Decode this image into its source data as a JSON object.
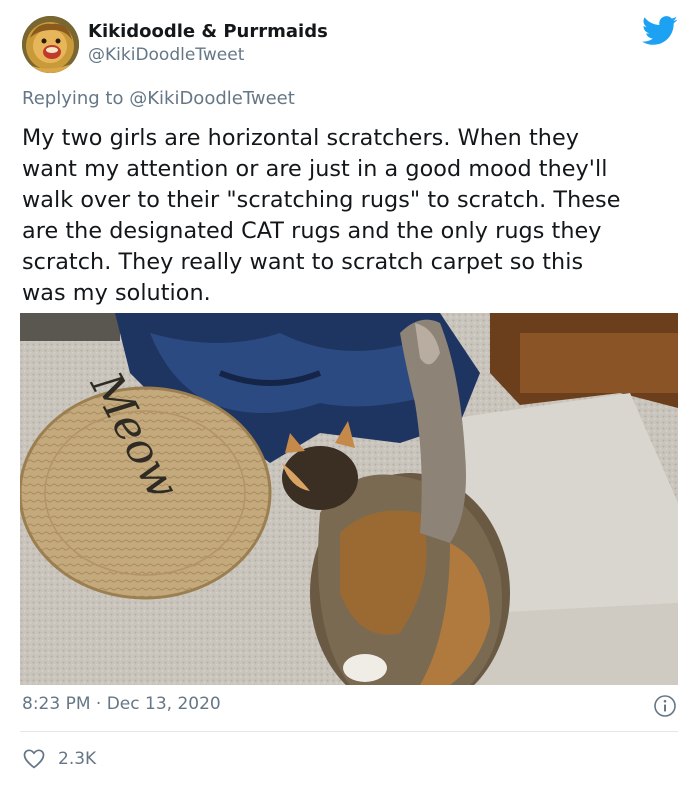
{
  "author": {
    "display_name": "Kikidoodle & Purrmaids",
    "handle": "@KikiDoodleTweet",
    "avatar_icon": "avatar-lion-image"
  },
  "reply": {
    "prefix": "Replying to",
    "mention": "@KikiDoodleTweet"
  },
  "tweet": {
    "lines": [
      "My two girls are horizontal scratchers. When they",
      "want my attention or are just in a good mood they'll",
      "walk over to their \"scratching rugs\" to scratch. These",
      "are the designated CAT rugs and the only rugs they",
      "scratch. They really want to scratch carpet so this",
      "was my solution."
    ]
  },
  "media": {
    "rug_text": "Meow"
  },
  "meta": {
    "time": "8:23 PM",
    "separator": "·",
    "date": "Dec 13, 2020"
  },
  "actions": {
    "like_count": "2.3K"
  },
  "colors": {
    "twitter_blue": "#1da1f2",
    "secondary_text": "#657786",
    "divider": "#e1e8ed"
  },
  "icons": {
    "brand": "twitter-bird-icon",
    "info": "info-icon",
    "like": "heart-icon"
  }
}
